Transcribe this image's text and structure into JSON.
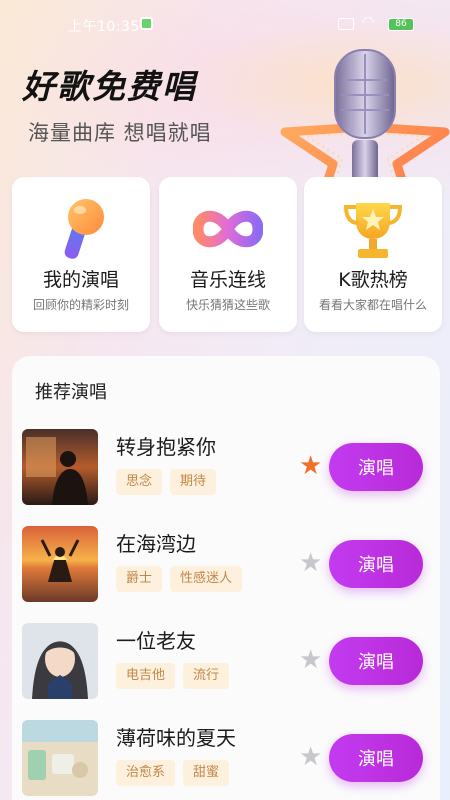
{
  "status_bar": {
    "time": "上午10:35",
    "battery": "86"
  },
  "hero": {
    "title": "好歌免费唱",
    "subtitle": "海量曲库 想唱就唱"
  },
  "feature_cards": [
    {
      "title": "我的演唱",
      "desc": "回顾你的精彩时刻",
      "icon": "microphone-icon"
    },
    {
      "title": "音乐连线",
      "desc": "快乐猜猜这些歌",
      "icon": "infinity-icon"
    },
    {
      "title": "K歌热榜",
      "desc": "看看大家都在唱什么",
      "icon": "trophy-icon"
    }
  ],
  "recommend": {
    "title": "推荐演唱",
    "button_label": "演唱",
    "songs": [
      {
        "name": "转身抱紧你",
        "tags": [
          "思念",
          "期待"
        ],
        "favorited": true
      },
      {
        "name": "在海湾边",
        "tags": [
          "爵士",
          "性感迷人"
        ],
        "favorited": false
      },
      {
        "name": "一位老友",
        "tags": [
          "电吉他",
          "流行"
        ],
        "favorited": false
      },
      {
        "name": "薄荷味的夏天",
        "tags": [
          "治愈系",
          "甜蜜"
        ],
        "favorited": false
      }
    ]
  },
  "colors": {
    "accent": "#c33bf0",
    "star_active": "#f2702e",
    "star_inactive": "#c8c8cc",
    "tag_bg": "#fdf0dc",
    "tag_text": "#c2884a"
  }
}
